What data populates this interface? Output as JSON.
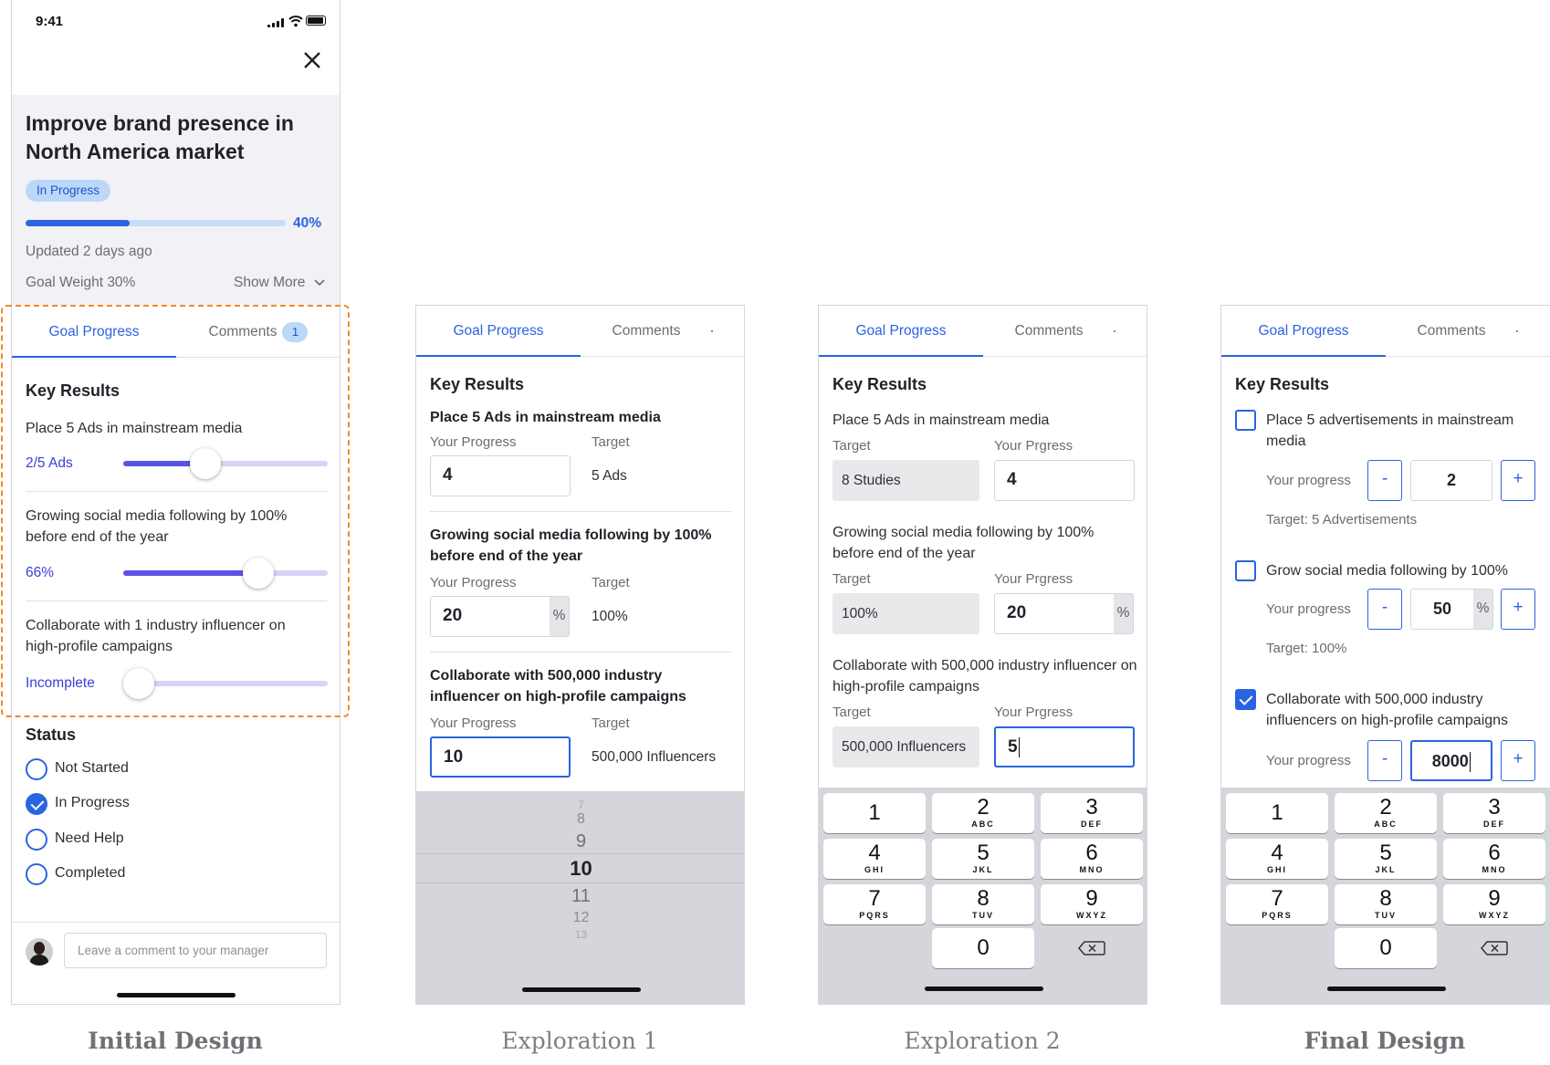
{
  "initial": {
    "status_time": "9:41",
    "title": "Improve brand presence in North America market",
    "badge": "In Progress",
    "progress_percent": 40,
    "progress_label": "40%",
    "updated": "Updated 2 days ago",
    "goal_weight": "Goal Weight 30%",
    "show_more": "Show More",
    "tabs": {
      "goal_progress": "Goal Progress",
      "comments": "Comments",
      "comments_count": "1"
    },
    "key_results_heading": "Key Results",
    "key_results": [
      {
        "text": "Place 5 Ads in mainstream media",
        "value_label": "2/5 Ads",
        "fraction": 0.4
      },
      {
        "text": "Growing social media following by 100% before end of the year",
        "value_label": "66%",
        "fraction": 0.66
      },
      {
        "text": "Collaborate with 1 industry influencer on high-profile campaigns",
        "value_label": "Incomplete",
        "fraction": 0.0
      }
    ],
    "status_heading": "Status",
    "status_options": [
      "Not Started",
      "In Progress",
      "Need Help",
      "Completed"
    ],
    "status_selected": "In Progress",
    "comment_placeholder": "Leave a comment to your manager",
    "caption": "Initial Design"
  },
  "exploration1": {
    "tabs": {
      "goal_progress": "Goal Progress",
      "comments": "Comments"
    },
    "key_results_heading": "Key Results",
    "key_results": [
      {
        "text": "Place 5 Ads in mainstream media",
        "progress_label": "Your Progress",
        "progress_value": "4",
        "target_label": "Target",
        "target_value": "5 Ads"
      },
      {
        "text": "Growing social media following by 100% before end of the year",
        "progress_label": "Your Progress",
        "progress_value": "20",
        "suffix": "%",
        "target_label": "Target",
        "target_value": "100%"
      },
      {
        "text": "Collaborate with 500,000 industry influencer on high-profile campaigns",
        "progress_label": "Your Progress",
        "progress_value": "10",
        "target_label": "Target",
        "target_value": "500,000 Influencers"
      }
    ],
    "picker": {
      "values": [
        "7",
        "8",
        "9",
        "10",
        "11",
        "12",
        "13"
      ],
      "selected": "10"
    },
    "caption": "Exploration 1"
  },
  "exploration2": {
    "tabs": {
      "goal_progress": "Goal Progress",
      "comments": "Comments"
    },
    "key_results_heading": "Key Results",
    "key_results": [
      {
        "text": "Place 5 Ads in mainstream media",
        "target_label": "Target",
        "target_value": "8 Studies",
        "progress_label": "Your Prgress",
        "progress_value": "4"
      },
      {
        "text": "Growing social media following by 100% before end of the year",
        "target_label": "Target",
        "target_value": "100%",
        "progress_label": "Your Prgress",
        "progress_value": "20",
        "suffix": "%"
      },
      {
        "text": "Collaborate with 500,000 industry influencer on high-profile campaigns",
        "target_label": "Target",
        "target_value": "500,000 Influencers",
        "progress_label": "Your Prgress",
        "progress_value": "5"
      }
    ],
    "caption": "Exploration 2"
  },
  "final": {
    "tabs": {
      "goal_progress": "Goal Progress",
      "comments": "Comments"
    },
    "key_results_heading": "Key Results",
    "key_results": [
      {
        "text": "Place 5 advertisements in mainstream media",
        "checked": false,
        "progress_label": "Your progress",
        "minus": "-",
        "value": "2",
        "plus": "+",
        "target": "Target: 5 Advertisements"
      },
      {
        "text": "Grow social media following by 100%",
        "checked": false,
        "progress_label": "Your progress",
        "minus": "-",
        "value": "50",
        "suffix": "%",
        "plus": "+",
        "target": "Target: 100%"
      },
      {
        "text": "Collaborate with 500,000 industry influencers on high-profile campaigns",
        "checked": true,
        "progress_label": "Your progress",
        "minus": "-",
        "value": "8000",
        "plus": "+"
      }
    ],
    "caption": "Final Design"
  },
  "keypad": {
    "keys": [
      {
        "num": "1",
        "sub": ""
      },
      {
        "num": "2",
        "sub": "ABC"
      },
      {
        "num": "3",
        "sub": "DEF"
      },
      {
        "num": "4",
        "sub": "GHI"
      },
      {
        "num": "5",
        "sub": "JKL"
      },
      {
        "num": "6",
        "sub": "MNO"
      },
      {
        "num": "7",
        "sub": "PQRS"
      },
      {
        "num": "8",
        "sub": "TUV"
      },
      {
        "num": "9",
        "sub": "WXYZ"
      },
      {
        "num": "0",
        "sub": ""
      }
    ]
  },
  "colors": {
    "accent": "#2a64e0",
    "slider": "#5b53e8",
    "highlight": "#f08a2c"
  }
}
